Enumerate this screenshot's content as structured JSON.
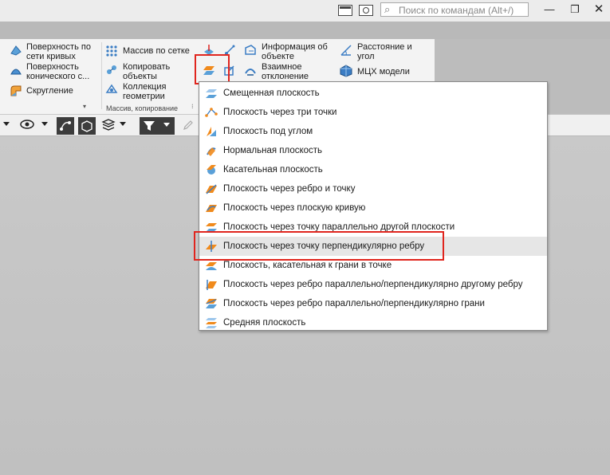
{
  "titlebar": {
    "search_placeholder": "Поиск по командам (Alt+/)",
    "minimize": "—",
    "maximize": "❐",
    "close": "✕"
  },
  "ribbon": {
    "surface_curves_1": "Поверхность по",
    "surface_curves_2": "сети кривых",
    "surface_conic_1": "Поверхность",
    "surface_conic_2": "конического с...",
    "fillet": "Скругление",
    "grid_array": "Массив по сетке",
    "copy_objects_1": "Копировать",
    "copy_objects_2": "объекты",
    "geom_collection_1": "Коллекция",
    "geom_collection_2": "геометрии",
    "group_array_copy": "Массив, копирование",
    "object_info_1": "Информация об",
    "object_info_2": "объекте",
    "mutual_deviation_1": "Взаимное",
    "mutual_deviation_2": "отклонение",
    "distance_angle_1": "Расстояние и",
    "distance_angle_2": "угол",
    "mcx_model": "МЦХ модели"
  },
  "menu": {
    "items": [
      {
        "label": "Смещенная плоскость",
        "icon": "offset-plane-icon"
      },
      {
        "label": "Плоскость через три точки",
        "icon": "three-point-plane-icon"
      },
      {
        "label": "Плоскость под углом",
        "icon": "angle-plane-icon"
      },
      {
        "label": "Нормальная плоскость",
        "icon": "normal-plane-icon"
      },
      {
        "label": "Касательная плоскость",
        "icon": "tangent-plane-icon"
      },
      {
        "label": "Плоскость через ребро и точку",
        "icon": "edge-point-plane-icon"
      },
      {
        "label": "Плоскость через плоскую кривую",
        "icon": "flat-curve-plane-icon"
      },
      {
        "label": "Плоскость через точку параллельно другой плоскости",
        "icon": "parallel-plane-icon"
      },
      {
        "label": "Плоскость через точку перпендикулярно ребру",
        "icon": "perpendicular-edge-plane-icon"
      },
      {
        "label": "Плоскость, касательная к грани в точке",
        "icon": "tangent-face-plane-icon"
      },
      {
        "label": "Плоскость через ребро параллельно/перпендикулярно другому ребру",
        "icon": "edge-edge-plane-icon"
      },
      {
        "label": "Плоскость через ребро параллельно/перпендикулярно грани",
        "icon": "edge-face-plane-icon"
      },
      {
        "label": "Средняя плоскость",
        "icon": "middle-plane-icon"
      }
    ],
    "highlighted_index": 8
  },
  "colors": {
    "accent_red": "#e0251e",
    "plane_orange": "#f08a1c",
    "plane_blue": "#5aa0d8"
  }
}
